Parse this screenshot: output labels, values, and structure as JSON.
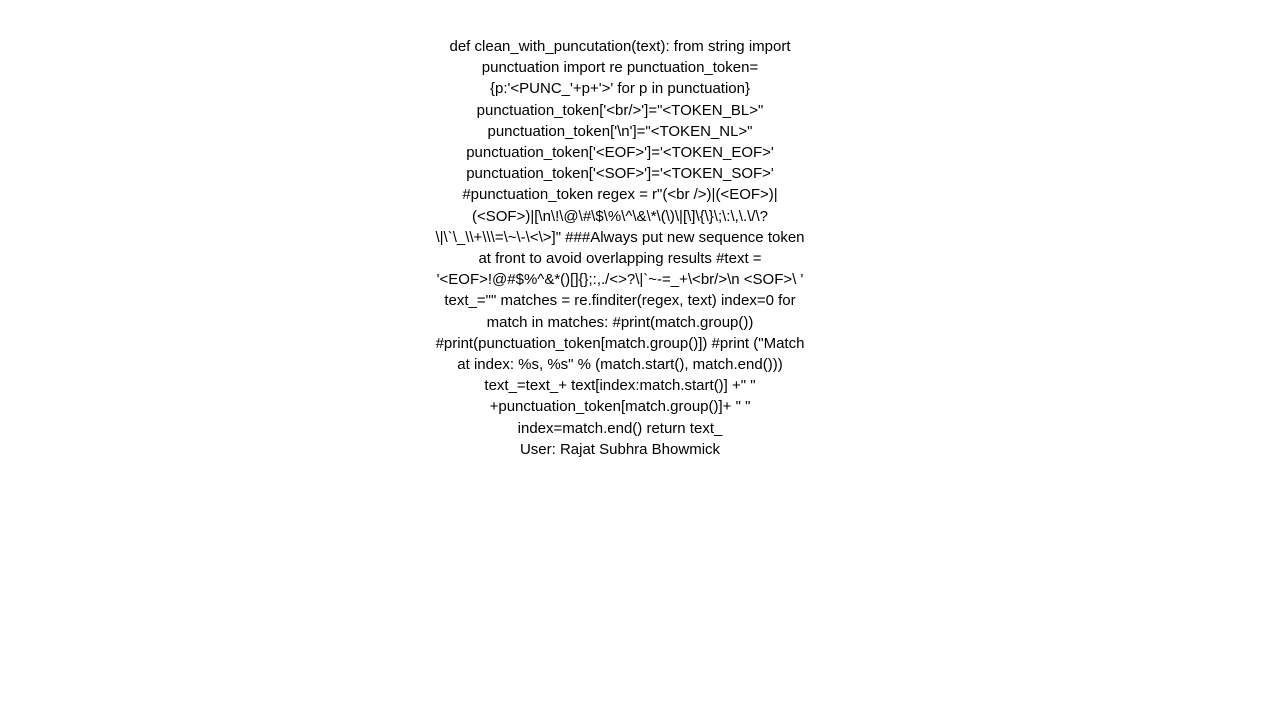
{
  "page": {
    "background_color": "#ffffff",
    "text_color": "#000000"
  },
  "content": {
    "code_text": "def clean_with_puncutation(text): from string import punctuation import re punctuation_token={p:'<PUNC_'+p+'>' for p in punctuation} punctuation_token['<br/>']=\"<TOKEN_BL>\" punctuation_token['\\n']=\"<TOKEN_NL>\" punctuation_token['<EOF>']='<TOKEN_EOF>' punctuation_token['<SOF>']='<TOKEN_SOF>' #punctuation_token     regex = r\"(<br />)|(<EOF>)|(<SOF>)|[\\n\\!\\@\\#\\$\\%\\^\\&\\*\\(\\)\\|[\\]\\{\\}\\;\\:\\,\\.\\/\\?\\|\\`\\_\\\\+\\\\\\=\\~\\-\\<\\>]\" ###Always put new sequence token at front to avoid overlapping results #text = '<EOF>!@#$%^&*()[]{};:,./<>?\\|`~-=_+\\<br/>\\n <SOF>\\ '    text_=\"\" matches = re.finditer(regex, text) index=0     for match in matches: #print(match.group()) #print(punctuation_token[match.group()]) #print (\"Match at index: %s, %s\" % (match.start(), match.end())) text_=text_+ text[index:match.start()] +\" \" +punctuation_token[match.group()]+ \" \" index=match.end()    return text_",
    "user_credit": "User: Rajat Subhra Bhowmick"
  }
}
